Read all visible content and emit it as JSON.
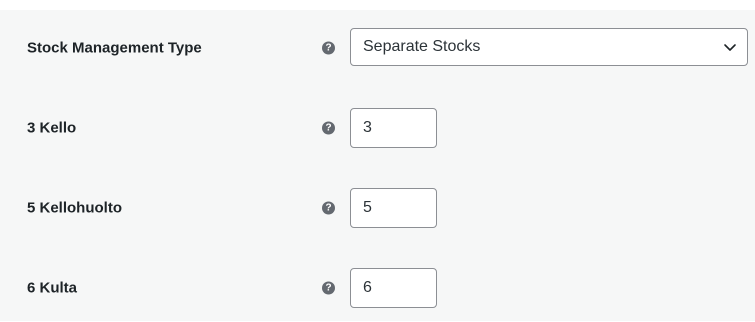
{
  "settings": {
    "stock_management": {
      "label": "Stock Management Type",
      "help_glyph": "?",
      "selected": "Separate Stocks",
      "icon": "chevron-down-icon"
    },
    "rows": [
      {
        "label": "3 Kello",
        "help_glyph": "?",
        "value": "3"
      },
      {
        "label": "5 Kellohuolto",
        "help_glyph": "?",
        "value": "5"
      },
      {
        "label": "6 Kulta",
        "help_glyph": "?",
        "value": "6"
      }
    ],
    "colors": {
      "panel_bg": "#f6f7f7",
      "border": "#8c8f94",
      "label_text": "#1d2327",
      "help_icon_bg": "#646970"
    }
  }
}
